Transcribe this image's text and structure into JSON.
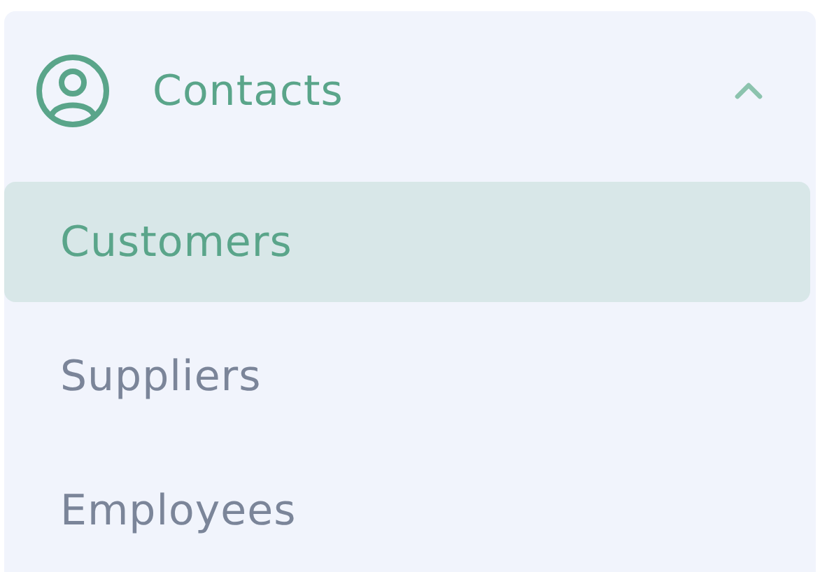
{
  "menu": {
    "title": "Contacts",
    "expanded": true,
    "items": [
      {
        "label": "Customers",
        "selected": true
      },
      {
        "label": "Suppliers",
        "selected": false
      },
      {
        "label": "Employees",
        "selected": false
      }
    ]
  }
}
